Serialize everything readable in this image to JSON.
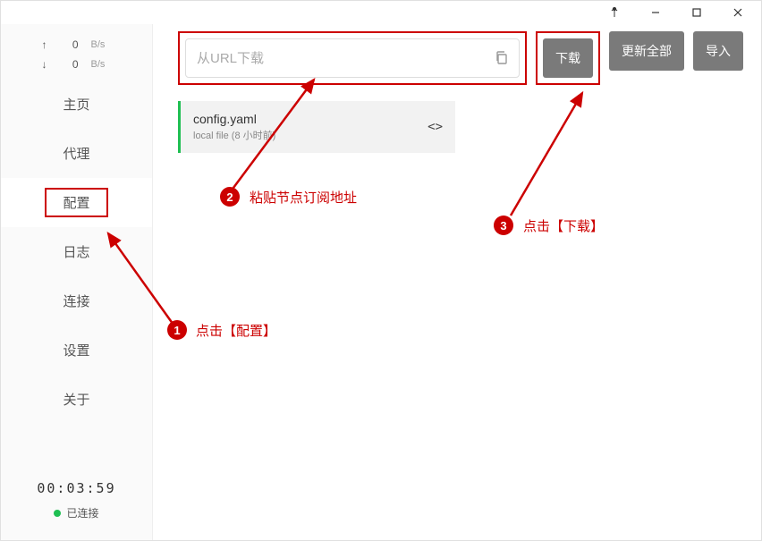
{
  "titlebar": {
    "pin_icon": "pin",
    "min_icon": "minimize",
    "max_icon": "maximize",
    "close_icon": "close"
  },
  "net": {
    "up_arrow": "↑",
    "up_value": "0",
    "up_unit": "B/s",
    "down_arrow": "↓",
    "down_value": "0",
    "down_unit": "B/s"
  },
  "nav": {
    "home": "主页",
    "proxy": "代理",
    "config": "配置",
    "log": "日志",
    "conn": "连接",
    "settings": "设置",
    "about": "关于"
  },
  "status": {
    "timer": "00:03:59",
    "connected": "已连接"
  },
  "url": {
    "placeholder": "从URL下载"
  },
  "buttons": {
    "download": "下载",
    "update_all": "更新全部",
    "import": "导入"
  },
  "card": {
    "name": "config.yaml",
    "meta": "local file (8 小时前)",
    "code_symbol": "<>"
  },
  "annotations": {
    "n1": "1",
    "t1": "点击【配置】",
    "n2": "2",
    "t2": "粘贴节点订阅地址",
    "n3": "3",
    "t3": "点击【下载】"
  }
}
